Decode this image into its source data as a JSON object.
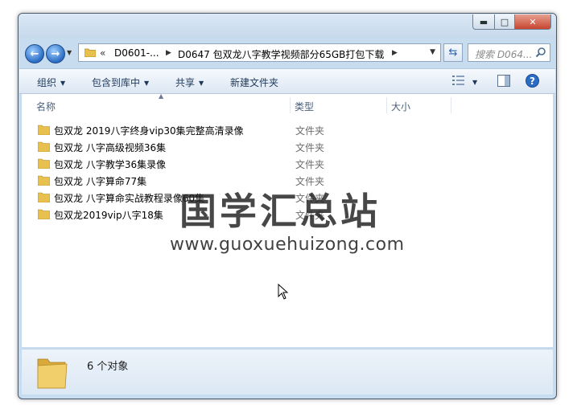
{
  "address": {
    "root_chevron": "«",
    "segments": [
      "D0601-...",
      "D0647 包双龙八字教学视频部分65GB打包下载"
    ],
    "search_placeholder": "搜索 D064..."
  },
  "toolbar": {
    "organize": "组织",
    "include_in_library": "包含到库中",
    "share": "共享",
    "new_folder": "新建文件夹"
  },
  "columns": {
    "name": "名称",
    "type": "类型",
    "size": "大小"
  },
  "files": [
    {
      "name": "包双龙 2019八字终身vip30集完整高清录像",
      "type": "文件夹"
    },
    {
      "name": "包双龙 八字高级视频36集",
      "type": "文件夹"
    },
    {
      "name": "包双龙 八字教学36集录像",
      "type": "文件夹"
    },
    {
      "name": "包双龙 八字算命77集",
      "type": "文件夹"
    },
    {
      "name": "包双龙 八字算命实战教程录像60集",
      "type": "文件夹"
    },
    {
      "name": "包双龙2019vip八字18集",
      "type": "文件夹"
    }
  ],
  "watermark": {
    "title": "国学汇总站",
    "url": "www.guoxuehuizong.com"
  },
  "details": {
    "count_text": "6 个对象"
  },
  "colors": {
    "folder": "#e8c04e",
    "accent": "#2b6cc4"
  }
}
